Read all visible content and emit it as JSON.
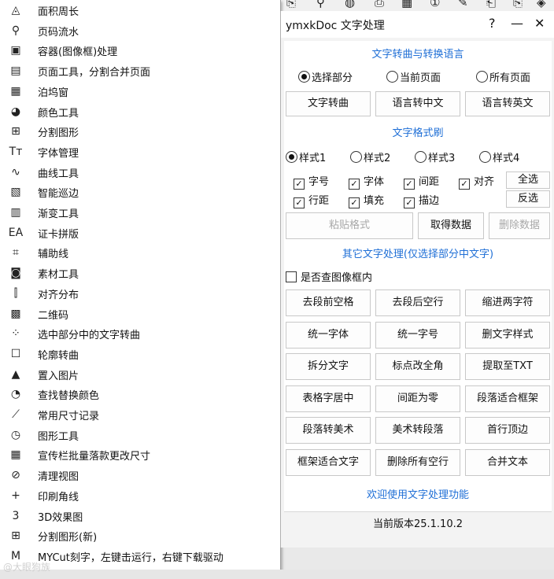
{
  "menu": {
    "items": [
      {
        "label": "面积周长",
        "icon": "area-icon"
      },
      {
        "label": "页码流水",
        "icon": "chain-icon"
      },
      {
        "label": "容器(图像框)处理",
        "icon": "container-icon"
      },
      {
        "label": "页面工具，分割合并页面",
        "icon": "page-tool-icon"
      },
      {
        "label": "泊坞窗",
        "icon": "docker-icon"
      },
      {
        "label": "颜色工具",
        "icon": "color-icon"
      },
      {
        "label": "分割图形",
        "icon": "split-icon"
      },
      {
        "label": "字体管理",
        "icon": "font-icon"
      },
      {
        "label": "曲线工具",
        "icon": "curve-icon"
      },
      {
        "label": "智能巡边",
        "icon": "smart-edge-icon"
      },
      {
        "label": "渐变工具",
        "icon": "gradient-icon"
      },
      {
        "label": "证卡拼版",
        "icon": "card-icon"
      },
      {
        "label": "辅助线",
        "icon": "guide-icon"
      },
      {
        "label": "素材工具",
        "icon": "material-icon"
      },
      {
        "label": "对齐分布",
        "icon": "align-icon"
      },
      {
        "label": "二维码",
        "icon": "qrcode-icon"
      },
      {
        "label": "选中部分中的文字转曲",
        "icon": "select-dots-icon"
      },
      {
        "label": "轮廓转曲",
        "icon": "outline-icon"
      },
      {
        "label": "置入图片",
        "icon": "image-icon"
      },
      {
        "label": "查找替换颜色",
        "icon": "replace-color-icon"
      },
      {
        "label": "常用尺寸记录",
        "icon": "ruler-icon"
      },
      {
        "label": "图形工具",
        "icon": "shape-tool-icon"
      },
      {
        "label": "宣传栏批量落款更改尺寸",
        "icon": "banner-icon"
      },
      {
        "label": "清理视图",
        "icon": "clean-view-icon"
      },
      {
        "label": "印刷角线",
        "icon": "crop-mark-icon"
      },
      {
        "label": "3D效果图",
        "icon": "3d-icon"
      },
      {
        "label": "分割图形(新)",
        "icon": "split-new-icon"
      },
      {
        "label": "MYCut刻字，左键击运行，右键下载驱动",
        "icon": "mycut-icon"
      }
    ],
    "icon_glyphs": [
      "◬",
      "⚲",
      "▣",
      "▤",
      "▦",
      "◕",
      "⊞",
      "Tт",
      "∿",
      "▧",
      "▥",
      "EA",
      "⌗",
      "◙",
      "⫿",
      "▩",
      "⁘",
      "☐",
      "▲",
      "◔",
      "⟋",
      "◷",
      "▦",
      "⊘",
      "+",
      "3",
      "⊞",
      "M"
    ]
  },
  "dialog": {
    "title": "ymxkDoc  文字处理",
    "help": "?",
    "minimize": "—",
    "close": "✕",
    "section1": "文字转曲与转换语言",
    "scope_radios": [
      {
        "label": "选择部分",
        "checked": true
      },
      {
        "label": "当前页面",
        "checked": false
      },
      {
        "label": "所有页面",
        "checked": false
      }
    ],
    "convert_buttons": [
      "文字转曲",
      "语言转中文",
      "语言转英文"
    ],
    "section2": "文字格式刷",
    "style_radios": [
      {
        "label": "样式1",
        "checked": true
      },
      {
        "label": "样式2",
        "checked": false
      },
      {
        "label": "样式3",
        "checked": false
      },
      {
        "label": "样式4",
        "checked": false
      }
    ],
    "format_checks": [
      {
        "label": "字号",
        "checked": true
      },
      {
        "label": "字体",
        "checked": true
      },
      {
        "label": "间距",
        "checked": true
      },
      {
        "label": "对齐",
        "checked": true
      },
      {
        "label": "行距",
        "checked": true
      },
      {
        "label": "填充",
        "checked": true
      },
      {
        "label": "描边",
        "checked": true
      }
    ],
    "select_all": "全选",
    "invert": "反选",
    "paste_format": "粘贴格式",
    "get_data": "取得数据",
    "delete_data": "删除数据",
    "section3": "其它文字处理(仅选择部分中文字)",
    "check_frame": {
      "label": "是否查图像框内",
      "checked": false
    },
    "grid_buttons": [
      "去段前空格",
      "去段后空行",
      "缩进两字符",
      "统一字体",
      "统一字号",
      "删文字样式",
      "拆分文字",
      "标点改全角",
      "提取至TXT",
      "表格字居中",
      "间距为零",
      "段落适合框架",
      "段落转美术",
      "美术转段落",
      "首行顶边",
      "框架适合文字",
      "删除所有空行",
      "合并文本"
    ],
    "welcome": "欢迎使用文字处理功能",
    "version": "当前版本25.1.10.2"
  },
  "toolbar_icons": [
    "⎘",
    "⚲",
    "◍",
    "⎙",
    "▦",
    "①",
    "✎",
    "⎗",
    "⎘",
    "◈"
  ],
  "watermark": "@大眼狗族"
}
